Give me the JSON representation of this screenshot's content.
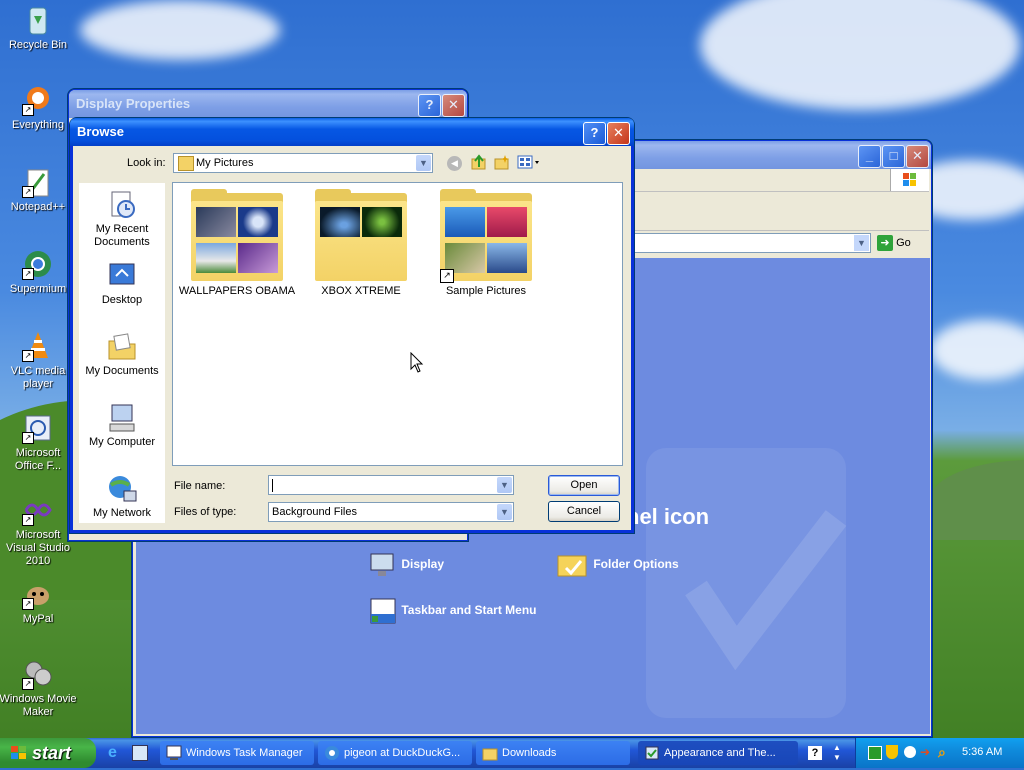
{
  "desktop": {
    "icons": [
      {
        "label": "Recycle Bin",
        "icon": "recycle-bin-icon"
      },
      {
        "label": "Everything",
        "icon": "everything-search-icon"
      },
      {
        "label": "Notepad++",
        "icon": "notepad-plus-plus-icon"
      },
      {
        "label": "Supermium",
        "icon": "supermium-browser-icon"
      },
      {
        "label": "VLC media player",
        "icon": "vlc-cone-icon"
      },
      {
        "label": "Microsoft Office F...",
        "icon": "office-icon"
      },
      {
        "label": "Microsoft Visual Studio 2010",
        "icon": "visual-studio-icon"
      },
      {
        "label": "MyPal",
        "icon": "mypal-browser-icon"
      },
      {
        "label": "Windows Movie Maker",
        "icon": "movie-maker-icon"
      }
    ]
  },
  "display_properties": {
    "title": "Display Properties"
  },
  "control_panel": {
    "address_go": "Go",
    "heading_fragment": "nel icon",
    "links": [
      {
        "label": "Display",
        "icon": "display-icon"
      },
      {
        "label": "Folder Options",
        "icon": "folder-options-icon"
      },
      {
        "label": "Taskbar and Start Menu",
        "icon": "taskbar-icon"
      }
    ]
  },
  "browse_dialog": {
    "title": "Browse",
    "look_in_label": "Look in:",
    "look_in_value": "My Pictures",
    "places": [
      {
        "label": "My Recent Documents",
        "icon": "recent-documents-icon"
      },
      {
        "label": "Desktop",
        "icon": "desktop-icon"
      },
      {
        "label": "My Documents",
        "icon": "my-documents-icon"
      },
      {
        "label": "My Computer",
        "icon": "my-computer-icon"
      },
      {
        "label": "My Network",
        "icon": "my-network-icon"
      }
    ],
    "folders": [
      {
        "label": "WALLPAPERS OBAMA"
      },
      {
        "label": "XBOX XTREME"
      },
      {
        "label": "Sample Pictures"
      }
    ],
    "file_name_label": "File name:",
    "file_name_value": "",
    "files_of_type_label": "Files of type:",
    "files_of_type_value": "Background Files",
    "open_label": "Open",
    "cancel_label": "Cancel"
  },
  "taskbar": {
    "start_label": "start",
    "tasks": [
      {
        "label": "Windows Task Manager"
      },
      {
        "label": "pigeon at DuckDuckG..."
      },
      {
        "label": "Downloads"
      },
      {
        "label": "Appearance and The..."
      }
    ],
    "clock": "5:36 AM"
  }
}
